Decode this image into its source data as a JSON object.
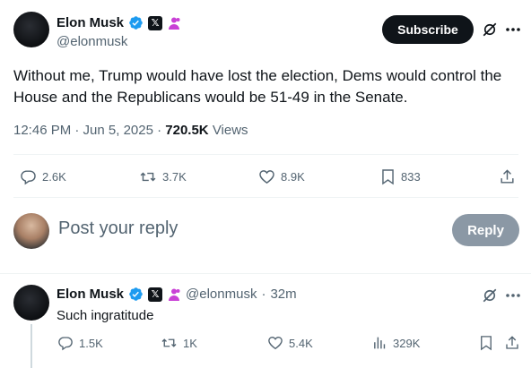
{
  "author": {
    "name": "Elon Musk",
    "handle": "@elonmusk"
  },
  "subscribe_label": "Subscribe",
  "main_tweet": {
    "text": "Without me, Trump would have lost the election, Dems would control the House and the Republicans would be 51-49 in the Senate.",
    "timestamp": "12:46 PM · Jun 5, 2025 · ",
    "views_count": "720.5K",
    "views_label": "Views",
    "replies": "2.6K",
    "reposts": "3.7K",
    "likes": "8.9K",
    "bookmarks": "833"
  },
  "reply_box": {
    "placeholder": "Post your reply",
    "button": "Reply"
  },
  "reply_tweet": {
    "name": "Elon Musk",
    "handle": "@elonmusk",
    "separator": "·",
    "time": "32m",
    "text": "Such ingratitude",
    "replies": "1.5K",
    "reposts": "1K",
    "likes": "5.4K",
    "views": "329K"
  },
  "colors": {
    "verified": "#1d9bf0",
    "affiliate": "#c940d6",
    "reply_button": "#8b98a5"
  },
  "icons": [
    "verified-check-icon",
    "x-affiliate-icon",
    "person-badge-icon",
    "grok-icon",
    "more-icon",
    "reply-icon",
    "repost-icon",
    "like-icon",
    "bookmark-icon",
    "share-icon",
    "views-icon"
  ]
}
